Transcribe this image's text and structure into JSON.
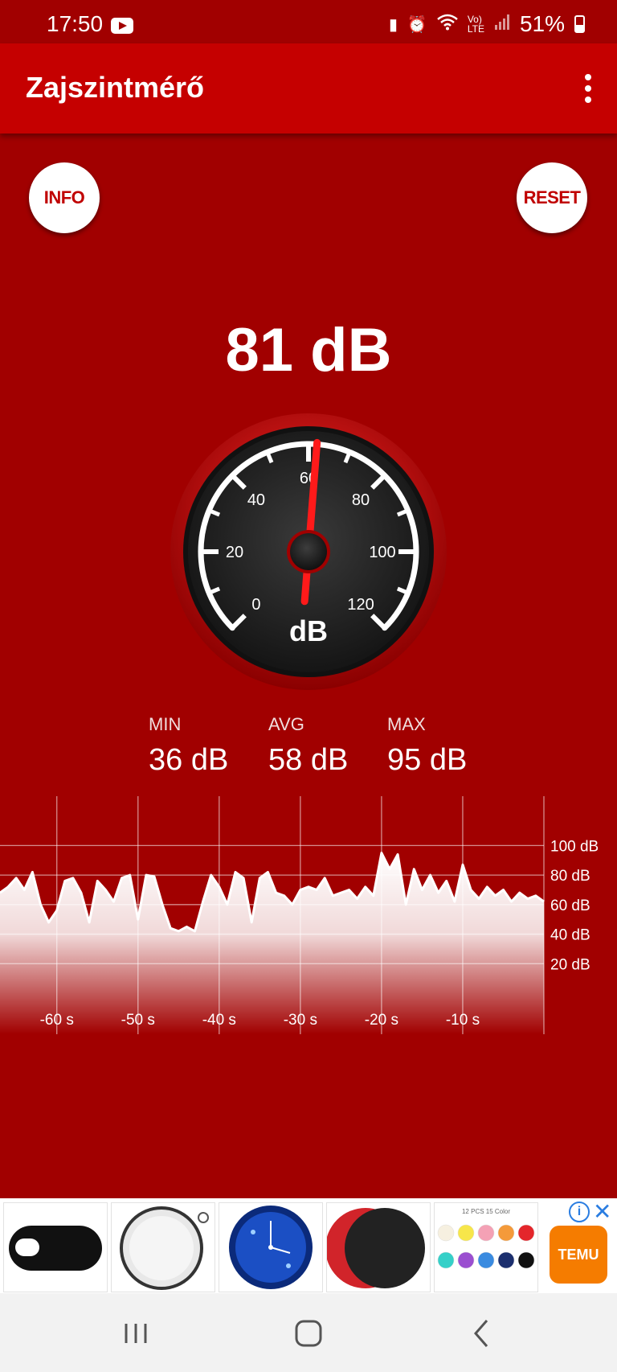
{
  "status_bar": {
    "time": "17:50",
    "battery": "51%",
    "battery_level": 0.51
  },
  "app": {
    "title": "Zajszintmérő"
  },
  "buttons": {
    "info": "INFO",
    "reset": "RESET"
  },
  "reading": {
    "current": "81 dB"
  },
  "gauge": {
    "unit": "dB",
    "labels": [
      "0",
      "20",
      "40",
      "60",
      "80",
      "100",
      "120"
    ],
    "needle_value": 62
  },
  "stats": {
    "min_label": "MIN",
    "min_value": "36 dB",
    "avg_label": "AVG",
    "avg_value": "58 dB",
    "max_label": "MAX",
    "max_value": "95 dB"
  },
  "chart_data": {
    "type": "area",
    "y_ticks": [
      "100 dB",
      "80 dB",
      "60 dB",
      "40 dB",
      "20 dB"
    ],
    "x_ticks": [
      "-60 s",
      "-50 s",
      "-40 s",
      "-30 s",
      "-20 s",
      "-10 s"
    ],
    "xlim": [
      -67,
      0
    ],
    "ylim": [
      0,
      110
    ],
    "series": [
      {
        "values": [
          [
            -67,
            68
          ],
          [
            -66,
            72
          ],
          [
            -65,
            78
          ],
          [
            -64,
            70
          ],
          [
            -63,
            82
          ],
          [
            -62,
            60
          ],
          [
            -61,
            48
          ],
          [
            -60,
            56
          ],
          [
            -59,
            76
          ],
          [
            -58,
            78
          ],
          [
            -57,
            68
          ],
          [
            -56,
            48
          ],
          [
            -55,
            76
          ],
          [
            -54,
            70
          ],
          [
            -53,
            62
          ],
          [
            -52,
            78
          ],
          [
            -51,
            80
          ],
          [
            -50,
            50
          ],
          [
            -49,
            80
          ],
          [
            -48,
            79
          ],
          [
            -47,
            60
          ],
          [
            -46,
            44
          ],
          [
            -45,
            42
          ],
          [
            -44,
            45
          ],
          [
            -43,
            42
          ],
          [
            -42,
            62
          ],
          [
            -41,
            80
          ],
          [
            -40,
            72
          ],
          [
            -39,
            60
          ],
          [
            -38,
            82
          ],
          [
            -37,
            78
          ],
          [
            -36,
            48
          ],
          [
            -35,
            78
          ],
          [
            -34,
            82
          ],
          [
            -33,
            68
          ],
          [
            -32,
            66
          ],
          [
            -31,
            60
          ],
          [
            -30,
            70
          ],
          [
            -29,
            72
          ],
          [
            -28,
            70
          ],
          [
            -27,
            78
          ],
          [
            -26,
            66
          ],
          [
            -25,
            68
          ],
          [
            -24,
            70
          ],
          [
            -23,
            64
          ],
          [
            -22,
            72
          ],
          [
            -21,
            66
          ],
          [
            -20,
            95
          ],
          [
            -19,
            84
          ],
          [
            -18,
            94
          ],
          [
            -17,
            60
          ],
          [
            -16,
            84
          ],
          [
            -15,
            70
          ],
          [
            -14,
            80
          ],
          [
            -13,
            68
          ],
          [
            -12,
            76
          ],
          [
            -11,
            62
          ],
          [
            -10,
            87
          ],
          [
            -9,
            70
          ],
          [
            -8,
            64
          ],
          [
            -7,
            72
          ],
          [
            -6,
            66
          ],
          [
            -5,
            70
          ],
          [
            -4,
            62
          ],
          [
            -3,
            68
          ],
          [
            -2,
            64
          ],
          [
            -1,
            66
          ],
          [
            0,
            62
          ]
        ]
      }
    ]
  },
  "ad": {
    "tiles": [
      "webcam-cover",
      "round-mirror",
      "wall-clock",
      "car-sun-shade",
      "color-swatch"
    ],
    "swatch_title": "12 PCS 15 Color",
    "brand": "TEMU",
    "brand_color": "#f57c00"
  },
  "nav": {
    "items": [
      "recents",
      "home",
      "back"
    ]
  },
  "colors": {
    "background": "#a10000",
    "app_bar": "#c50000",
    "needle": "#ff1a1a"
  }
}
